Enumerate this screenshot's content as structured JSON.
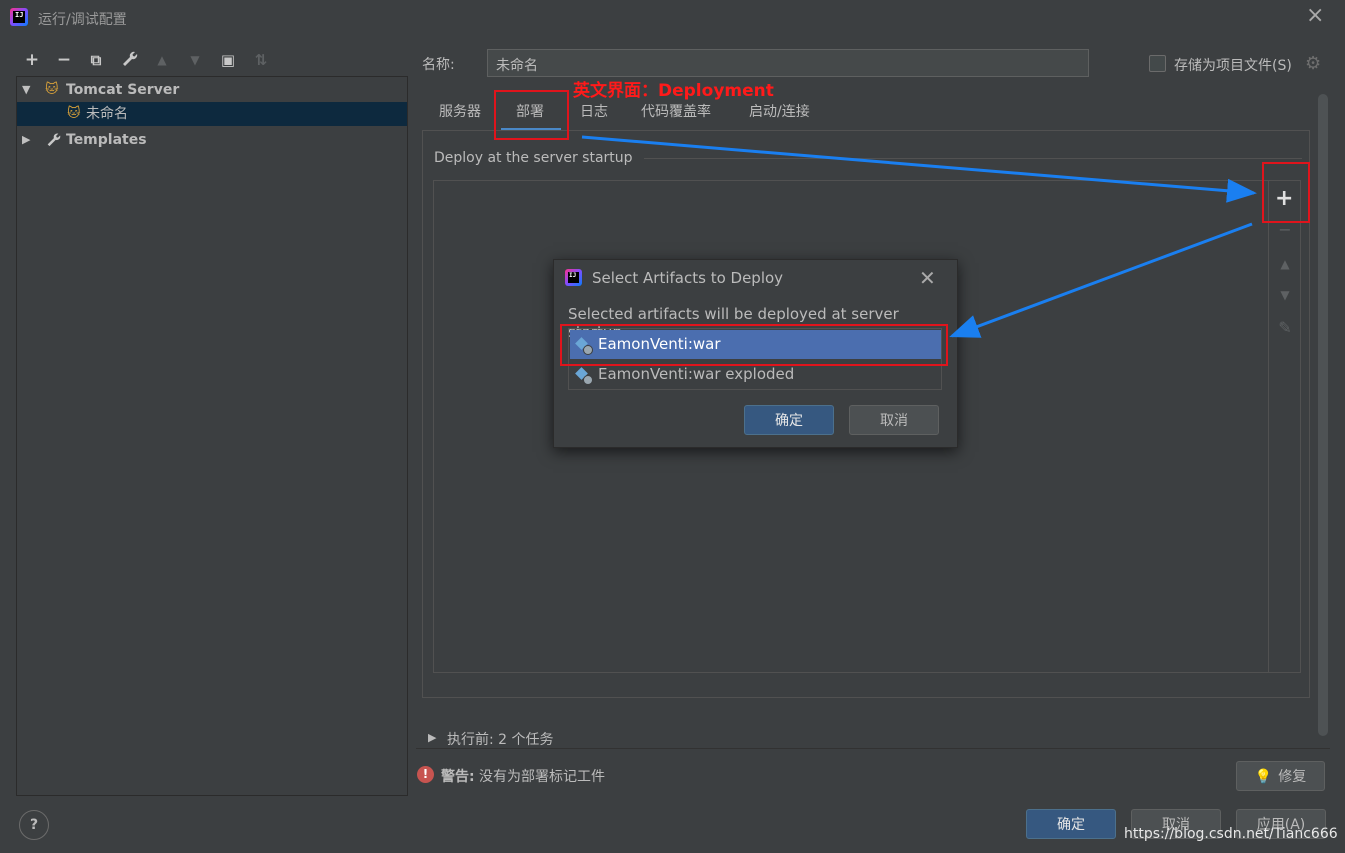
{
  "window": {
    "title": "运行/调试配置",
    "app_icon_text": "IJ"
  },
  "toolbar": {
    "icons": [
      "add-icon",
      "remove-icon",
      "copy-icon",
      "wrench-icon",
      "move-up-icon",
      "move-down-icon",
      "new-folder-icon",
      "sort-icon"
    ],
    "add": "+",
    "remove": "−",
    "copy": "⧉",
    "wrench": "🔧",
    "up": "▲",
    "down": "▼",
    "folder": "▣",
    "sort": "⇅"
  },
  "tree": {
    "items": [
      {
        "label": "Tomcat Server",
        "expanded": true,
        "icon": "tomcat-icon"
      },
      {
        "label": "未命名",
        "selected": true,
        "icon": "tomcat-config-icon"
      },
      {
        "label": "Templates",
        "expanded": false,
        "icon": "wrench-icon"
      }
    ],
    "expanded_arrow": "▼",
    "collapsed_arrow": "▶"
  },
  "config": {
    "name_label": "名称:",
    "name_value": "未命名",
    "store_as_project_file": "存储为项目文件(S)",
    "tabs": [
      {
        "label": "服务器"
      },
      {
        "label": "部署",
        "active": true
      },
      {
        "label": "日志"
      },
      {
        "label": "代码覆盖率"
      },
      {
        "label": "启动/连接"
      }
    ],
    "deploy_legend": "Deploy at the server startup",
    "side_buttons": {
      "add": "+",
      "remove": "−",
      "up": "▲",
      "down": "▼",
      "edit": "✎"
    },
    "before_launch": "执行前: 2 个任务",
    "warning_bold": "警告:",
    "warning_text": " 没有为部署标记工件",
    "fix_label": "修复",
    "help": "?",
    "ok": "确定",
    "cancel": "取消",
    "apply": "应用(A)"
  },
  "dialog": {
    "title": "Select Artifacts to Deploy",
    "description": "Selected artifacts will be deployed at server startup",
    "artifacts": [
      {
        "label": "EamonVenti:war",
        "selected": true
      },
      {
        "label": "EamonVenti:war exploded",
        "selected": false
      }
    ],
    "ok": "确定",
    "cancel": "取消"
  },
  "annotation": {
    "text": "英文界面：Deployment",
    "color": "#e0141c",
    "arrow_color": "#1a7ff0"
  },
  "watermark": "https://blog.csdn.net/Tianc666",
  "colors": {
    "background": "#3c3f41",
    "selection": "#0d293e",
    "list_selection": "#4b6eaf",
    "primary_button": "#365880",
    "tab_underline": "#4a88c7"
  }
}
